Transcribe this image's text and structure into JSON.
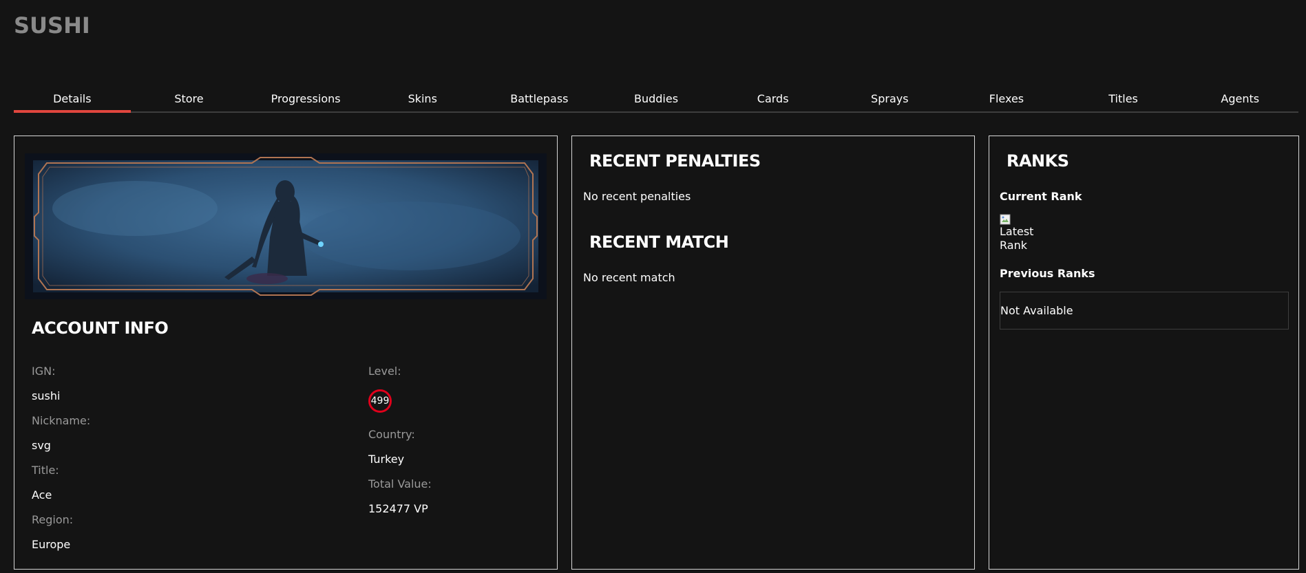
{
  "app": {
    "title": "SUSHI"
  },
  "tabs": [
    {
      "label": "Details",
      "active": true
    },
    {
      "label": "Store"
    },
    {
      "label": "Progressions"
    },
    {
      "label": "Skins"
    },
    {
      "label": "Battlepass"
    },
    {
      "label": "Buddies"
    },
    {
      "label": "Cards"
    },
    {
      "label": "Sprays"
    },
    {
      "label": "Flexes"
    },
    {
      "label": "Titles"
    },
    {
      "label": "Agents"
    }
  ],
  "account": {
    "heading": "ACCOUNT INFO",
    "ign_label": "IGN:",
    "ign_value": "sushi",
    "nickname_label": "Nickname:",
    "nickname_value": "svg",
    "title_label": "Title:",
    "title_value": "Ace",
    "region_label": "Region:",
    "region_value": "Europe",
    "level_label": "Level:",
    "level_value": "499",
    "country_label": "Country:",
    "country_value": "Turkey",
    "total_value_label": "Total Value:",
    "total_value_value": "152477 VP"
  },
  "activity": {
    "penalties_heading": "RECENT PENALTIES",
    "penalties_text": "No recent penalties",
    "match_heading": "RECENT MATCH",
    "match_text": "No recent match"
  },
  "ranks": {
    "heading": "RANKS",
    "current_label": "Current Rank",
    "current_image_alt": "Latest Rank",
    "previous_label": "Previous Ranks",
    "previous_value": "Not Available"
  },
  "colors": {
    "background": "#141414",
    "accent": "#e1463e",
    "level_ring": "#e0001b",
    "border": "#d8d8d8"
  }
}
